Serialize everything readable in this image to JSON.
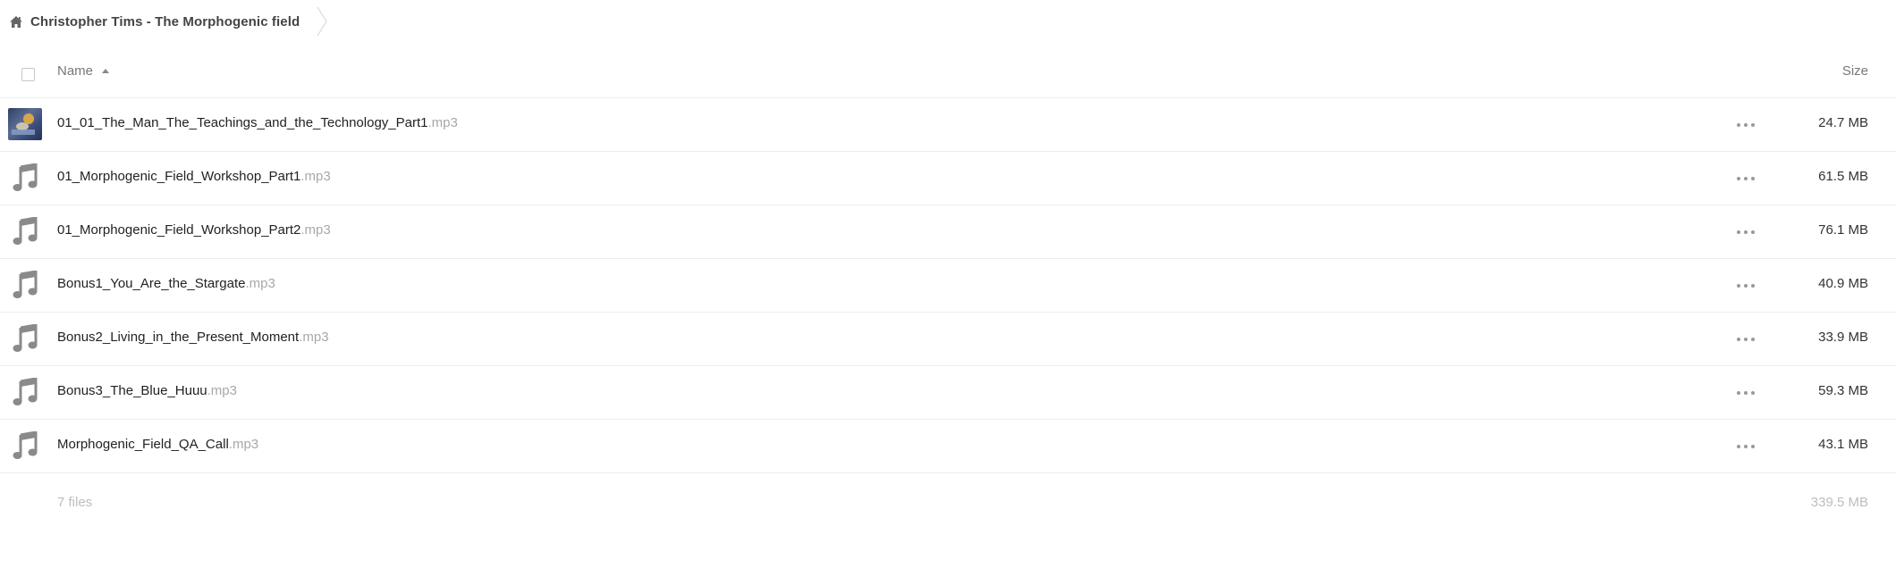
{
  "breadcrumb": {
    "title": "Christopher Tims - The Morphogenic field",
    "home_icon": "home-icon",
    "separator_icon": "chevron-right-icon"
  },
  "table": {
    "header": {
      "name_label": "Name",
      "size_label": "Size",
      "sort_icon": "sort-ascending-icon"
    },
    "files": [
      {
        "name": "01_01_The_Man_The_Teachings_and_the_Technology_Part1",
        "ext": ".mp3",
        "size": "24.7 MB",
        "icon": "album-art-thumbnail"
      },
      {
        "name": "01_Morphogenic_Field_Workshop_Part1",
        "ext": ".mp3",
        "size": "61.5 MB",
        "icon": "music-note-icon"
      },
      {
        "name": "01_Morphogenic_Field_Workshop_Part2",
        "ext": ".mp3",
        "size": "76.1 MB",
        "icon": "music-note-icon"
      },
      {
        "name": "Bonus1_You_Are_the_Stargate",
        "ext": ".mp3",
        "size": "40.9 MB",
        "icon": "music-note-icon"
      },
      {
        "name": "Bonus2_Living_in_the_Present_Moment",
        "ext": ".mp3",
        "size": "33.9 MB",
        "icon": "music-note-icon"
      },
      {
        "name": "Bonus3_The_Blue_Huuu",
        "ext": ".mp3",
        "size": "59.3 MB",
        "icon": "music-note-icon"
      },
      {
        "name": "Morphogenic_Field_QA_Call",
        "ext": ".mp3",
        "size": "43.1 MB",
        "icon": "music-note-icon"
      }
    ],
    "summary": {
      "count_label": "7 files",
      "total_size": "339.5 MB"
    }
  },
  "colors": {
    "icon_gray": "#8a8a8a",
    "ext_gray": "#a8a8a8",
    "divider": "#ededed",
    "summary_text": "#bdbdbd"
  }
}
